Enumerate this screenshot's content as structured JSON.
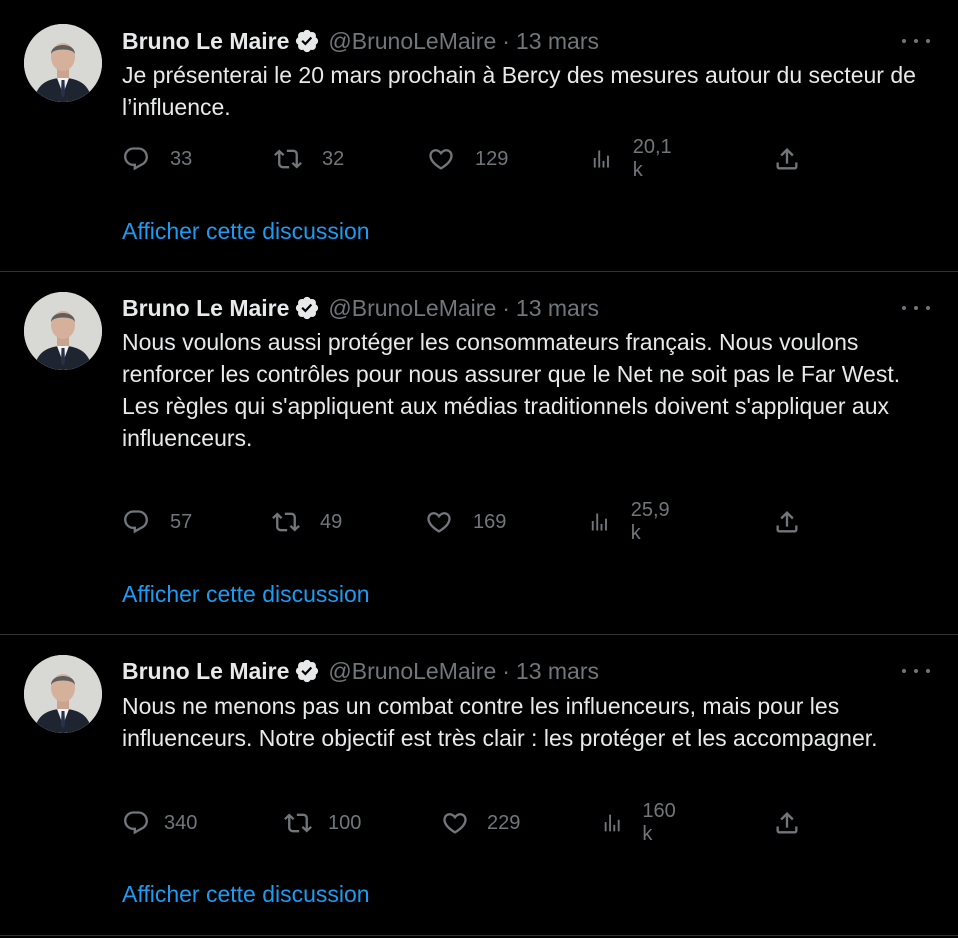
{
  "colors": {
    "background": "#000000",
    "text_primary": "#e7e9ea",
    "text_secondary": "#71767b",
    "link": "#1d9bf0",
    "verified_badge": "#e7e9ea"
  },
  "tweets": [
    {
      "author": "Bruno Le Maire",
      "handle": "@BrunoLeMaire",
      "separator": "·",
      "date": "13 mars",
      "text": "Je présenterai le 20 mars prochain à Bercy des mesures autour du secteur de l’influence.",
      "replies": "33",
      "retweets": "32",
      "likes": "129",
      "views": "20,1 k",
      "show_thread": "Afficher cette discussion"
    },
    {
      "author": "Bruno Le Maire",
      "handle": "@BrunoLeMaire",
      "separator": "·",
      "date": "13 mars",
      "text": "Nous voulons aussi protéger les consommateurs français. Nous voulons renforcer les contrôles pour nous assurer que le Net ne soit pas le Far West.\nLes règles qui s'appliquent aux médias traditionnels doivent s'appliquer aux influenceurs.",
      "replies": "57",
      "retweets": "49",
      "likes": "169",
      "views": "25,9 k",
      "show_thread": "Afficher cette discussion"
    },
    {
      "author": "Bruno Le Maire",
      "handle": "@BrunoLeMaire",
      "separator": "·",
      "date": "13 mars",
      "text": "Nous ne menons pas un combat contre les influenceurs, mais pour les influenceurs. Notre objectif est très clair : les protéger et les accompagner.",
      "replies": "340",
      "retweets": "100",
      "likes": "229",
      "views": "160 k",
      "show_thread": "Afficher cette discussion"
    }
  ]
}
